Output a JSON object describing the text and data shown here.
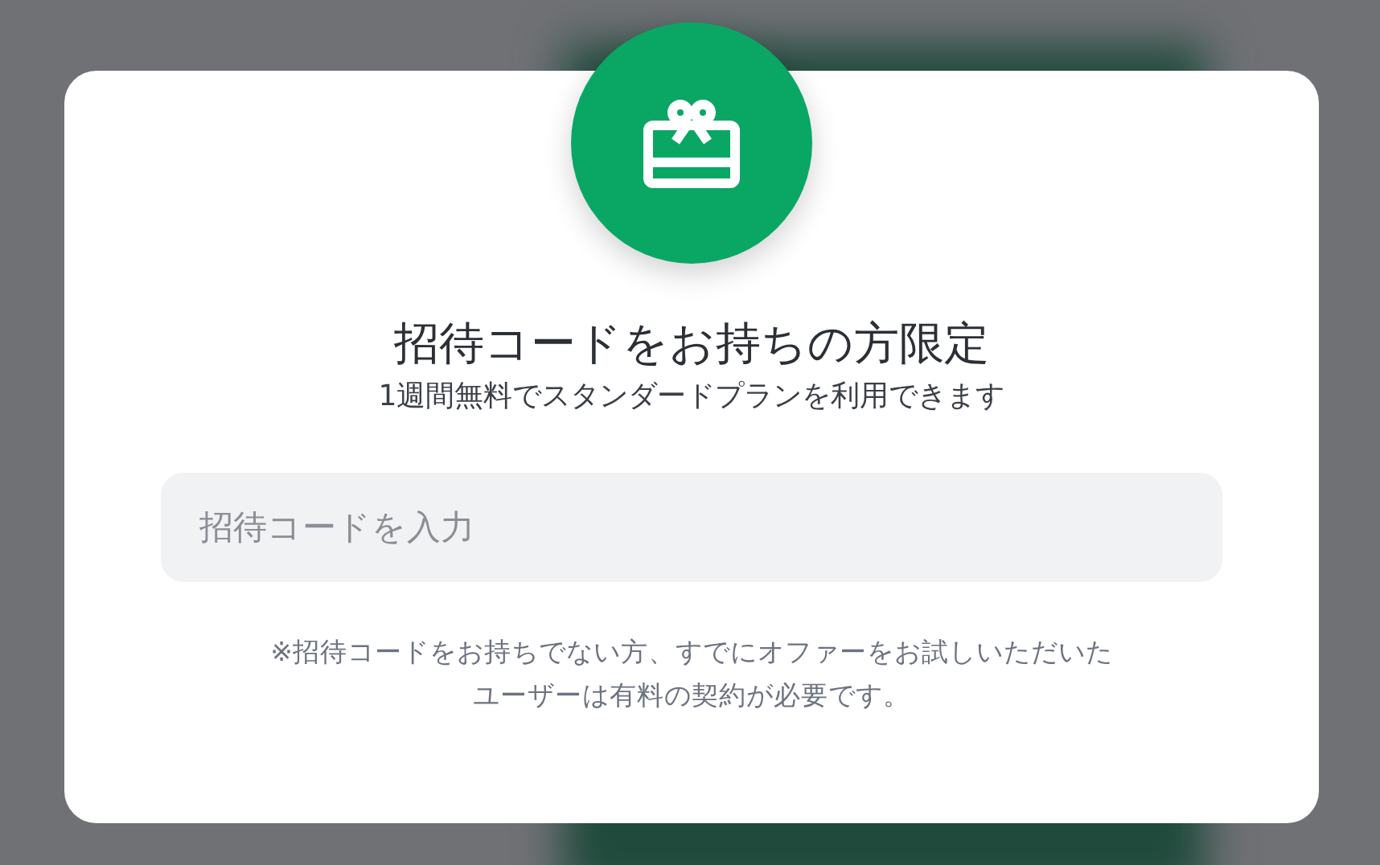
{
  "dialog": {
    "title": "招待コードをお持ちの方限定",
    "subtitle": "1週間無料でスタンダードプランを利用できます",
    "code_field": {
      "placeholder": "招待コードを入力"
    },
    "note": "※招待コードをお持ちでない方、すでにオファーをお試しいただいたユーザーは有料の契約が必要です。"
  }
}
